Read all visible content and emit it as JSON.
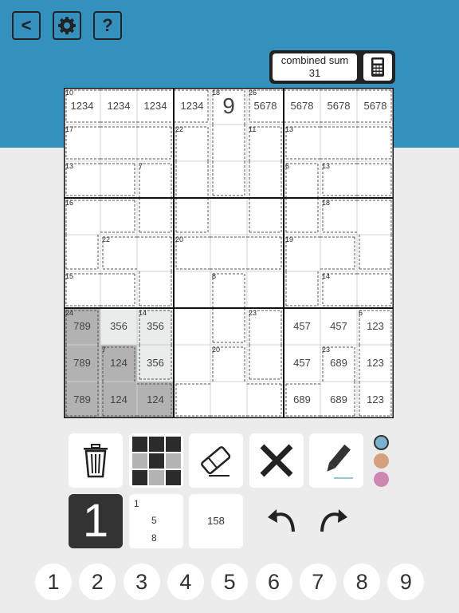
{
  "toolbar": {
    "back_label": "<",
    "help_label": "?"
  },
  "combined_sum": {
    "label": "combined sum",
    "value": "31"
  },
  "cells": [
    {
      "r": 0,
      "c": 0,
      "t": "1234"
    },
    {
      "r": 0,
      "c": 1,
      "t": "1234"
    },
    {
      "r": 0,
      "c": 2,
      "t": "1234"
    },
    {
      "r": 0,
      "c": 3,
      "t": "1234"
    },
    {
      "r": 0,
      "c": 4,
      "t": "9",
      "big": true
    },
    {
      "r": 0,
      "c": 5,
      "t": "5678"
    },
    {
      "r": 0,
      "c": 6,
      "t": "5678"
    },
    {
      "r": 0,
      "c": 7,
      "t": "5678"
    },
    {
      "r": 0,
      "c": 8,
      "t": "5678"
    },
    {
      "r": 6,
      "c": 0,
      "t": "789"
    },
    {
      "r": 6,
      "c": 1,
      "t": "356"
    },
    {
      "r": 6,
      "c": 2,
      "t": "356"
    },
    {
      "r": 6,
      "c": 6,
      "t": "457"
    },
    {
      "r": 6,
      "c": 7,
      "t": "457"
    },
    {
      "r": 6,
      "c": 8,
      "t": "123"
    },
    {
      "r": 7,
      "c": 0,
      "t": "789"
    },
    {
      "r": 7,
      "c": 1,
      "t": "124"
    },
    {
      "r": 7,
      "c": 2,
      "t": "356"
    },
    {
      "r": 7,
      "c": 6,
      "t": "457"
    },
    {
      "r": 7,
      "c": 7,
      "t": "689"
    },
    {
      "r": 7,
      "c": 8,
      "t": "123"
    },
    {
      "r": 8,
      "c": 0,
      "t": "789"
    },
    {
      "r": 8,
      "c": 1,
      "t": "124"
    },
    {
      "r": 8,
      "c": 2,
      "t": "124"
    },
    {
      "r": 8,
      "c": 6,
      "t": "689"
    },
    {
      "r": 8,
      "c": 7,
      "t": "689"
    },
    {
      "r": 8,
      "c": 8,
      "t": "123"
    }
  ],
  "cages": [
    {
      "sum": "10",
      "cells": [
        [
          0,
          0
        ],
        [
          0,
          1
        ],
        [
          0,
          2
        ],
        [
          0,
          3
        ]
      ]
    },
    {
      "sum": "18",
      "cells": [
        [
          0,
          4
        ],
        [
          1,
          4
        ],
        [
          2,
          4
        ]
      ]
    },
    {
      "sum": "26",
      "cells": [
        [
          0,
          5
        ],
        [
          0,
          6
        ],
        [
          0,
          7
        ],
        [
          0,
          8
        ]
      ]
    },
    {
      "sum": "17",
      "cells": [
        [
          1,
          0
        ],
        [
          1,
          1
        ],
        [
          1,
          2
        ]
      ]
    },
    {
      "sum": "22",
      "cells": [
        [
          1,
          3
        ],
        [
          2,
          3
        ],
        [
          3,
          3
        ]
      ]
    },
    {
      "sum": "11",
      "cells": [
        [
          1,
          5
        ],
        [
          2,
          5
        ],
        [
          3,
          5
        ]
      ]
    },
    {
      "sum": "13",
      "cells": [
        [
          1,
          6
        ],
        [
          1,
          7
        ],
        [
          1,
          8
        ]
      ]
    },
    {
      "sum": "13",
      "cells": [
        [
          2,
          0
        ],
        [
          2,
          1
        ]
      ]
    },
    {
      "sum": "7",
      "cells": [
        [
          2,
          2
        ],
        [
          3,
          2
        ]
      ]
    },
    {
      "sum": "6",
      "cells": [
        [
          2,
          6
        ],
        [
          3,
          6
        ]
      ]
    },
    {
      "sum": "13",
      "cells": [
        [
          2,
          7
        ],
        [
          2,
          8
        ]
      ]
    },
    {
      "sum": "16",
      "cells": [
        [
          3,
          0
        ],
        [
          3,
          1
        ],
        [
          4,
          0
        ]
      ]
    },
    {
      "sum": "18",
      "cells": [
        [
          3,
          7
        ],
        [
          3,
          8
        ],
        [
          4,
          8
        ]
      ]
    },
    {
      "sum": "22",
      "cells": [
        [
          4,
          1
        ],
        [
          4,
          2
        ],
        [
          5,
          2
        ]
      ]
    },
    {
      "sum": "20",
      "cells": [
        [
          4,
          3
        ],
        [
          4,
          4
        ],
        [
          4,
          5
        ]
      ]
    },
    {
      "sum": "19",
      "cells": [
        [
          4,
          6
        ],
        [
          4,
          7
        ],
        [
          5,
          6
        ]
      ]
    },
    {
      "sum": "15",
      "cells": [
        [
          5,
          0
        ],
        [
          5,
          1
        ]
      ]
    },
    {
      "sum": "8",
      "cells": [
        [
          5,
          4
        ],
        [
          6,
          4
        ]
      ]
    },
    {
      "sum": "14",
      "cells": [
        [
          5,
          7
        ],
        [
          5,
          8
        ]
      ]
    },
    {
      "sum": "24",
      "cells": [
        [
          6,
          0
        ],
        [
          7,
          0
        ],
        [
          8,
          0
        ]
      ]
    },
    {
      "sum": "14",
      "cells": [
        [
          6,
          2
        ],
        [
          7,
          2
        ]
      ]
    },
    {
      "sum": "23",
      "cells": [
        [
          6,
          5
        ],
        [
          7,
          5
        ]
      ]
    },
    {
      "sum": "6",
      "cells": [
        [
          6,
          8
        ],
        [
          7,
          8
        ],
        [
          8,
          8
        ]
      ]
    },
    {
      "sum": "7",
      "cells": [
        [
          7,
          1
        ],
        [
          8,
          1
        ],
        [
          8,
          2
        ]
      ]
    },
    {
      "sum": "20",
      "cells": [
        [
          7,
          4
        ],
        [
          8,
          3
        ],
        [
          8,
          4
        ],
        [
          8,
          5
        ]
      ]
    },
    {
      "sum": "23",
      "cells": [
        [
          7,
          7
        ],
        [
          8,
          7
        ],
        [
          8,
          6
        ]
      ]
    }
  ],
  "shaded": {
    "dark": [
      [
        6,
        0
      ],
      [
        7,
        0
      ],
      [
        8,
        0
      ],
      [
        7,
        1
      ],
      [
        8,
        1
      ],
      [
        8,
        2
      ]
    ],
    "light": [
      [
        6,
        1
      ],
      [
        6,
        2
      ],
      [
        7,
        2
      ]
    ],
    "color_dark": "#b2b2b2",
    "color_light": "#e8eceb"
  },
  "tools": {
    "dots": [
      "#7ab3d0",
      "#d5a07e",
      "#cf86b0"
    ]
  },
  "modes": {
    "big_digit": "1",
    "corner_digits": [
      "1",
      "5",
      "8"
    ],
    "center_digits": "158"
  },
  "numbers": [
    "1",
    "2",
    "3",
    "4",
    "5",
    "6",
    "7",
    "8",
    "9"
  ],
  "colors": {
    "accent": "#3490bd"
  }
}
